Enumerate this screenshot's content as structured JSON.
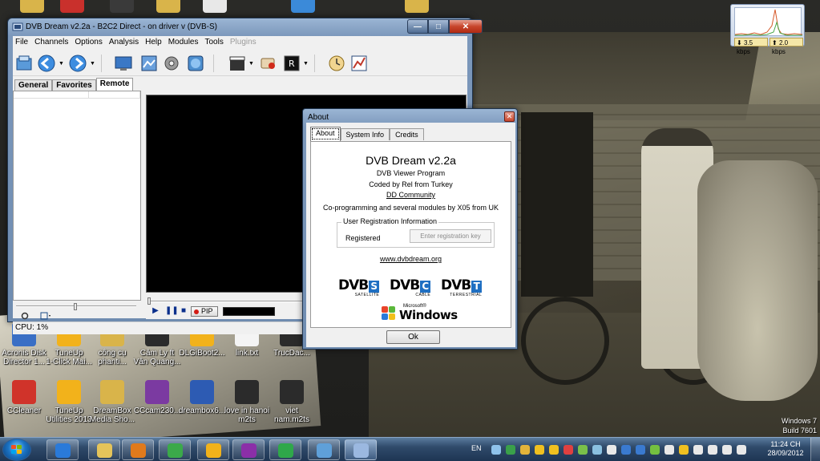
{
  "desktop": {
    "icons_top": [
      {
        "color": "#d9b44a"
      },
      {
        "color": "#c9302c"
      },
      {
        "color": "#3a3a3a"
      },
      {
        "color": "#d9b44a"
      },
      {
        "color": "#e8e8e8"
      },
      {
        "color": "#3b8ad9"
      },
      {
        "color": "#d9b44a"
      }
    ],
    "icons_row1": [
      {
        "label": "Acronis Disk\nDirector 1...",
        "color": "#3a6fc5"
      },
      {
        "label": "TuneUp\n1-Click Mai...",
        "color": "#f2b21b"
      },
      {
        "label": "công cụ\nphanti...",
        "color": "#d9b44a"
      },
      {
        "label": "Cảm Ly ft\nVân Quang...",
        "color": "#2b2b2b"
      },
      {
        "label": "DLGiBoot2...",
        "color": "#f2b21b"
      },
      {
        "label": "link.txt",
        "color": "#f4f4f4"
      },
      {
        "label": "TrucDac...",
        "color": "#2b2b2b"
      }
    ],
    "icons_row2": [
      {
        "label": "CCleaner",
        "color": "#d0332a"
      },
      {
        "label": "TuneUp\nUtilities 2013",
        "color": "#f2b21b"
      },
      {
        "label": "DreamBox\nMedia Sho...",
        "color": "#d9b44a"
      },
      {
        "label": "CCcam230...",
        "color": "#7b3aa1"
      },
      {
        "label": "dreambox6...",
        "color": "#2d5bb3"
      },
      {
        "label": "love in hanoi\nm2ts",
        "color": "#2b2b2b"
      },
      {
        "label": "viet\nnam.m2ts",
        "color": "#2b2b2b"
      }
    ],
    "watermark": {
      "line1": "Windows 7",
      "line2": "Build 7601"
    }
  },
  "gadget": {
    "download": "3.5 kbps",
    "upload": "2.0 kbps"
  },
  "dvb_window": {
    "title": "DVB Dream v2.2a - B2C2 Direct - on driver v (DVB-S)",
    "caption": {
      "minimize": "—",
      "maximize": "□",
      "close": "✕"
    },
    "menu": [
      {
        "label": "File",
        "enabled": true
      },
      {
        "label": "Channels",
        "enabled": true
      },
      {
        "label": "Options",
        "enabled": true
      },
      {
        "label": "Analysis",
        "enabled": true
      },
      {
        "label": "Help",
        "enabled": true
      },
      {
        "label": "Modules",
        "enabled": true
      },
      {
        "label": "Tools",
        "enabled": true
      },
      {
        "label": "Plugins",
        "enabled": false
      }
    ],
    "toolbar_icons": [
      "open-icon",
      "back-icon",
      "forward-icon",
      "monitor-icon",
      "screenshot-icon",
      "settings-icon",
      "globe-icon",
      "clapper-icon",
      "record-icon",
      "epg-icon",
      "clock-icon",
      "chart-icon"
    ],
    "tabs": [
      {
        "label": "General",
        "active": false
      },
      {
        "label": "Favorites",
        "active": false
      },
      {
        "label": "Remote",
        "active": true
      }
    ],
    "pip_label": "PIP",
    "status": "CPU: 1%"
  },
  "about": {
    "title": "About",
    "close": "✕",
    "tabs": [
      {
        "label": "About",
        "active": true
      },
      {
        "label": "System Info",
        "active": false
      },
      {
        "label": "Credits",
        "active": false
      }
    ],
    "app_name": "DVB Dream v2.2a",
    "subtitle": "DVB Viewer Program",
    "coded_by": "Coded by Rel from Turkey",
    "community": "DD Community",
    "coprog": "Co-programming and several modules by X05 from UK",
    "registration": {
      "legend": "User Registration Information",
      "label": "Registered",
      "placeholder": "Enter registration key"
    },
    "website": "www.dvbdream.org",
    "logos": [
      {
        "text": "DVB",
        "letter": "S",
        "caption": "SATELLITE",
        "color": "#1f6fc2"
      },
      {
        "text": "DVB",
        "letter": "C",
        "caption": "CABLE",
        "color": "#1f6fc2"
      },
      {
        "text": "DVB",
        "letter": "T",
        "caption": "TERRESTRIAL",
        "color": "#1f6fc2"
      }
    ],
    "ms_small": "Microsoft®",
    "ms_windows": "Windows",
    "ok": "Ok"
  },
  "taskbar": {
    "buttons": [
      {
        "icon": "ie-icon",
        "color": "#2a7ad9",
        "active": false
      },
      {
        "icon": "explorer-icon",
        "color": "#e5c45a",
        "active": false
      },
      {
        "icon": "media-player-icon",
        "color": "#e07a1c",
        "active": false
      },
      {
        "icon": "chrome-icon",
        "color": "#3ba94a",
        "active": false
      },
      {
        "icon": "tuneup-icon",
        "color": "#f2b21b",
        "active": false
      },
      {
        "icon": "yahoo-icon",
        "color": "#8b2fa8",
        "active": false
      },
      {
        "icon": "network-icon",
        "color": "#2fa84a",
        "active": false
      },
      {
        "icon": "window-icon",
        "color": "#5fa0d9",
        "active": false
      },
      {
        "icon": "dvb-dream-icon",
        "color": "#9bb8e0",
        "active": true
      }
    ],
    "language": "EN",
    "tray_colors": [
      "#8fc2ea",
      "#3aa04a",
      "#e2b33a",
      "#f0c020",
      "#f0c020",
      "#e04040",
      "#7ac04a",
      "#8ac0e0",
      "#e8e8e8",
      "#3a7ad0",
      "#3a7ad0",
      "#74c040",
      "#e8e8e8",
      "#f0c020",
      "#e8e8e8",
      "#e8e8e8",
      "#e8e8e8",
      "#e8e8e8"
    ],
    "clock": {
      "time": "11:24 CH",
      "date": "28/09/2012"
    }
  }
}
